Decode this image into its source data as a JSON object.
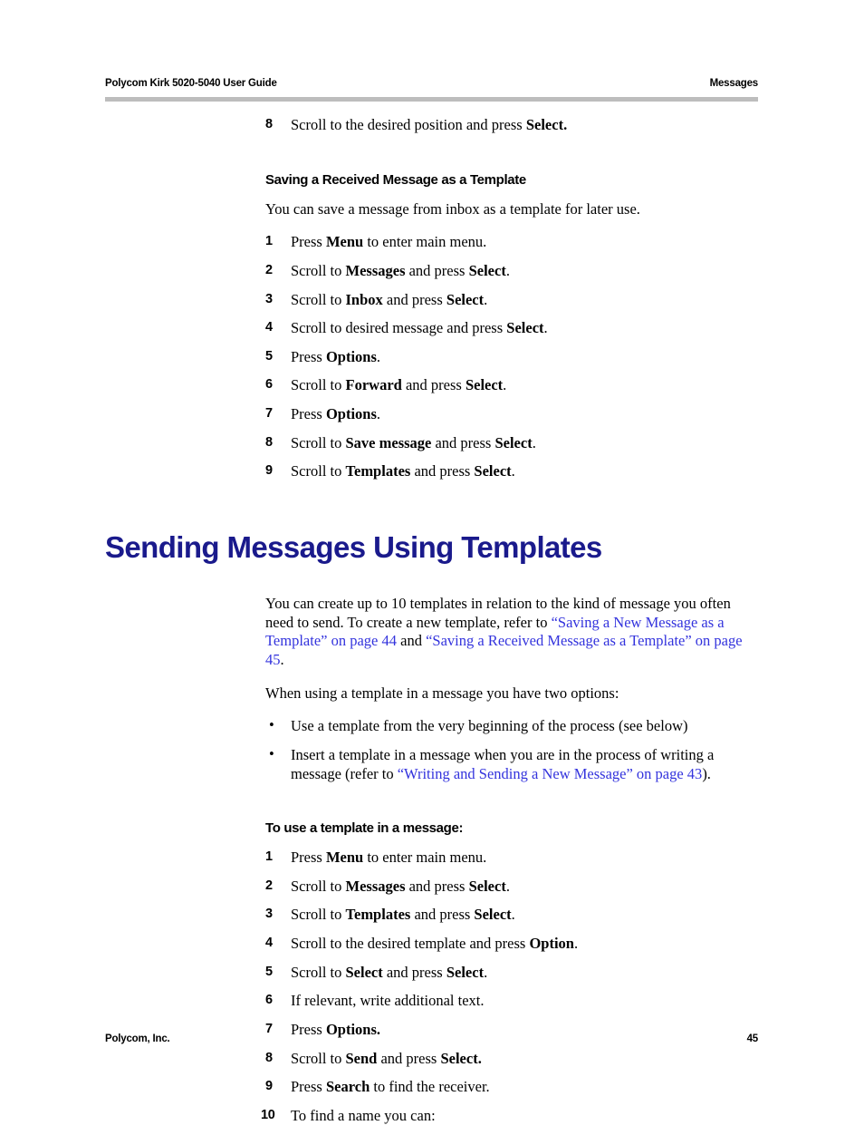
{
  "header": {
    "left": "Polycom Kirk 5020-5040 User Guide",
    "right": "Messages"
  },
  "footer": {
    "left": "Polycom, Inc.",
    "page_number": "45"
  },
  "colors": {
    "heading_blue": "#1a1a8c",
    "link_blue": "#3333dd",
    "rule_gray": "#bdbdbd"
  },
  "top_step": {
    "number": "8",
    "text_before": "Scroll to the desired position and press ",
    "bold": "Select.",
    "text_after": ""
  },
  "section_saving": {
    "heading": "Saving a Received Message as a Template",
    "intro": "You can save a message from inbox as a template for later use.",
    "steps": [
      {
        "number": "1",
        "pre": "Press ",
        "bold": "Menu",
        "post": " to enter main menu."
      },
      {
        "number": "2",
        "pre": "Scroll to ",
        "bold": "Messages",
        "mid": " and press ",
        "bold2": "Select",
        "post": "."
      },
      {
        "number": "3",
        "pre": "Scroll to ",
        "bold": "Inbox",
        "mid": " and press ",
        "bold2": "Select",
        "post": "."
      },
      {
        "number": "4",
        "pre": "Scroll to desired message and press ",
        "bold": "Select",
        "post": "."
      },
      {
        "number": "5",
        "pre": "Press ",
        "bold": "Options",
        "post": "."
      },
      {
        "number": "6",
        "pre": "Scroll to ",
        "bold": "Forward",
        "mid": " and press ",
        "bold2": "Select",
        "post": "."
      },
      {
        "number": "7",
        "pre": "Press ",
        "bold": "Options",
        "post": "."
      },
      {
        "number": "8",
        "pre": "Scroll to ",
        "bold": "Save message",
        "mid": " and press ",
        "bold2": "Select",
        "post": "."
      },
      {
        "number": "9",
        "pre": "Scroll to ",
        "bold": "Templates",
        "mid": " and press ",
        "bold2": "Select",
        "post": "."
      }
    ]
  },
  "section_sending": {
    "title": "Sending Messages Using Templates",
    "para1_a": "You can create up to 10 templates in relation to the kind of message you often need to send. To create a new template, refer to ",
    "para1_link1": "“Saving a New Message as a Template” on page 44",
    "para1_b": " and ",
    "para1_link2": "“Saving a Received Message as a Template” on page 45",
    "para1_c": ".",
    "para2": "When using a template in a message you have two options:",
    "bullets": [
      {
        "text": "Use a template from the very beginning of the process (see below)",
        "link": "",
        "post": ""
      },
      {
        "text": "Insert a template in a message when you are in the process of writing a message (refer to ",
        "link": "“Writing and Sending a New Message” on page 43",
        "post": ")."
      }
    ],
    "procedure_heading": "To use a template in a message:",
    "steps": [
      {
        "number": "1",
        "pre": "Press ",
        "bold": "Menu",
        "post": " to enter main menu."
      },
      {
        "number": "2",
        "pre": "Scroll to ",
        "bold": "Messages",
        "mid": " and press ",
        "bold2": "Select",
        "post": "."
      },
      {
        "number": "3",
        "pre": "Scroll to ",
        "bold": "Templates",
        "mid": " and press ",
        "bold2": "Select",
        "post": "."
      },
      {
        "number": "4",
        "pre": "Scroll to the desired template and press ",
        "bold": "Option",
        "post": "."
      },
      {
        "number": "5",
        "pre": "Scroll to ",
        "bold": "Select",
        "mid": " and press ",
        "bold2": "Select",
        "post": "."
      },
      {
        "number": "6",
        "pre": "If relevant, write additional text.",
        "bold": "",
        "post": ""
      },
      {
        "number": "7",
        "pre": "Press ",
        "bold": "Options.",
        "post": ""
      },
      {
        "number": "8",
        "pre": "Scroll to ",
        "bold": "Send",
        "mid": " and press ",
        "bold2": "Select.",
        "post": ""
      },
      {
        "number": "9",
        "pre": "Press ",
        "bold": "Search",
        "post": " to find the receiver."
      },
      {
        "number": "10",
        "pre": "To find a name you can:",
        "bold": "",
        "post": ""
      }
    ]
  }
}
